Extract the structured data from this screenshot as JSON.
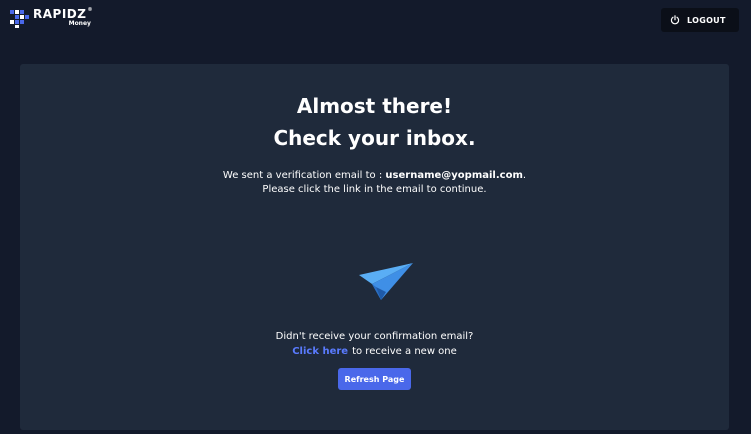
{
  "header": {
    "logo_name": "RAPIDZ",
    "logo_reg": "®",
    "logo_sub": "Money",
    "logout_label": "LOGOUT",
    "logout_icon": "power-icon"
  },
  "card": {
    "title_line1": "Almost there!",
    "title_line2": "Check your inbox.",
    "message_prefix": "We sent a verification email to :",
    "email": "username@yopmail.com",
    "message_suffix": ".",
    "message_line2": "Please click the link in the email to continue.",
    "illustration_icon": "paper-plane-icon",
    "resend_question": "Didn't receive your confirmation email?",
    "resend_link": "Click here",
    "resend_suffix": "to receive a new one",
    "refresh_label": "Refresh Page"
  },
  "colors": {
    "background": "#131a2b",
    "card": "#1f2a3b",
    "accent": "#4a68ea",
    "link": "#5a7bff",
    "plane": "#4a9ef0"
  }
}
